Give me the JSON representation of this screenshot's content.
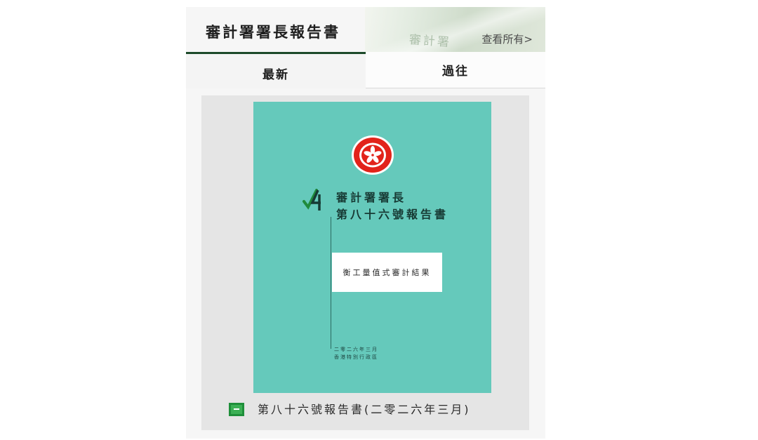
{
  "header": {
    "title": "審計署署長報告書",
    "view_all": "查看所有>",
    "background_text": "審計署"
  },
  "tabs": [
    {
      "label": "最新",
      "active": true
    },
    {
      "label": "過往",
      "active": false
    }
  ],
  "cover": {
    "title_line1": "審計署署長",
    "title_line2": "第八十六號報告書",
    "subtitle": "衡工量值式審計結果",
    "small_line1": "二零二六年三月",
    "small_line2": "香港特別行政區",
    "background_color": "#65c9bb"
  },
  "report": {
    "link_label": "第八十六號報告書(二零二六年三月)",
    "icon": "pdf-icon"
  },
  "colors": {
    "accent": "#1d4a2a",
    "cover": "#65c9bb",
    "pdf_icon": "#1f8f3a"
  }
}
